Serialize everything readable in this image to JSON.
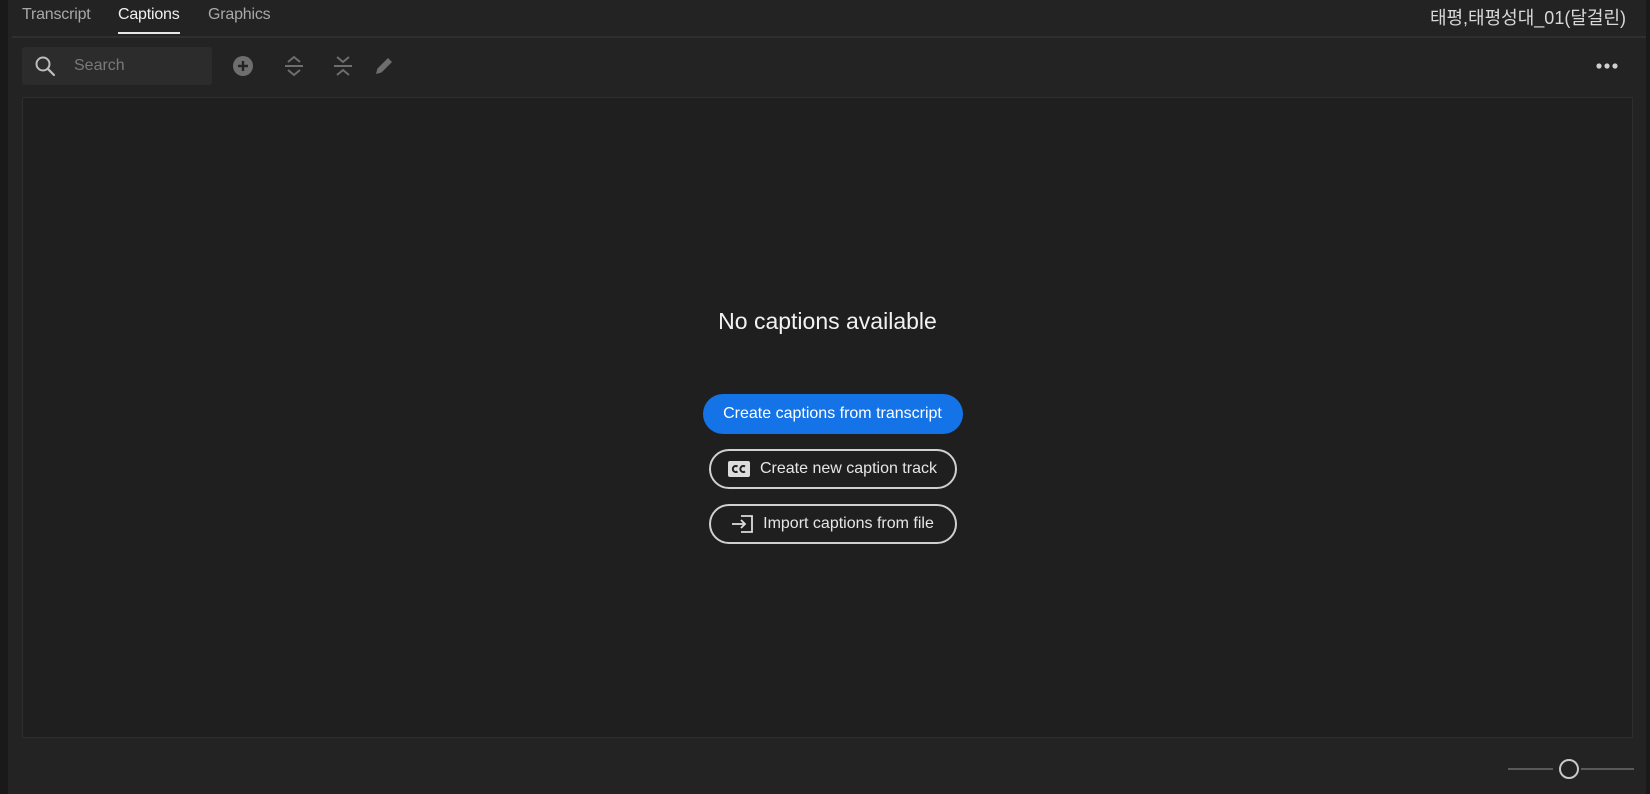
{
  "tabs": [
    {
      "label": "Transcript",
      "active": false
    },
    {
      "label": "Captions",
      "active": true
    },
    {
      "label": "Graphics",
      "active": false
    }
  ],
  "doc_title": "태평,태평성대_01(달걸린)",
  "toolbar": {
    "search_placeholder": "Search",
    "search_value": "",
    "icons": [
      "search-icon",
      "add-icon",
      "expand-icon",
      "collapse-icon",
      "edit-icon",
      "more-icon"
    ]
  },
  "empty_state": {
    "title": "No captions available",
    "create_from_transcript": "Create captions from transcript",
    "create_new_track": "Create new caption track",
    "import_from_file": "Import captions from file"
  },
  "zoom": {
    "level": 0.5
  },
  "colors": {
    "accent": "#1473e6",
    "background": "#232323",
    "panel": "#1f1f1f"
  }
}
